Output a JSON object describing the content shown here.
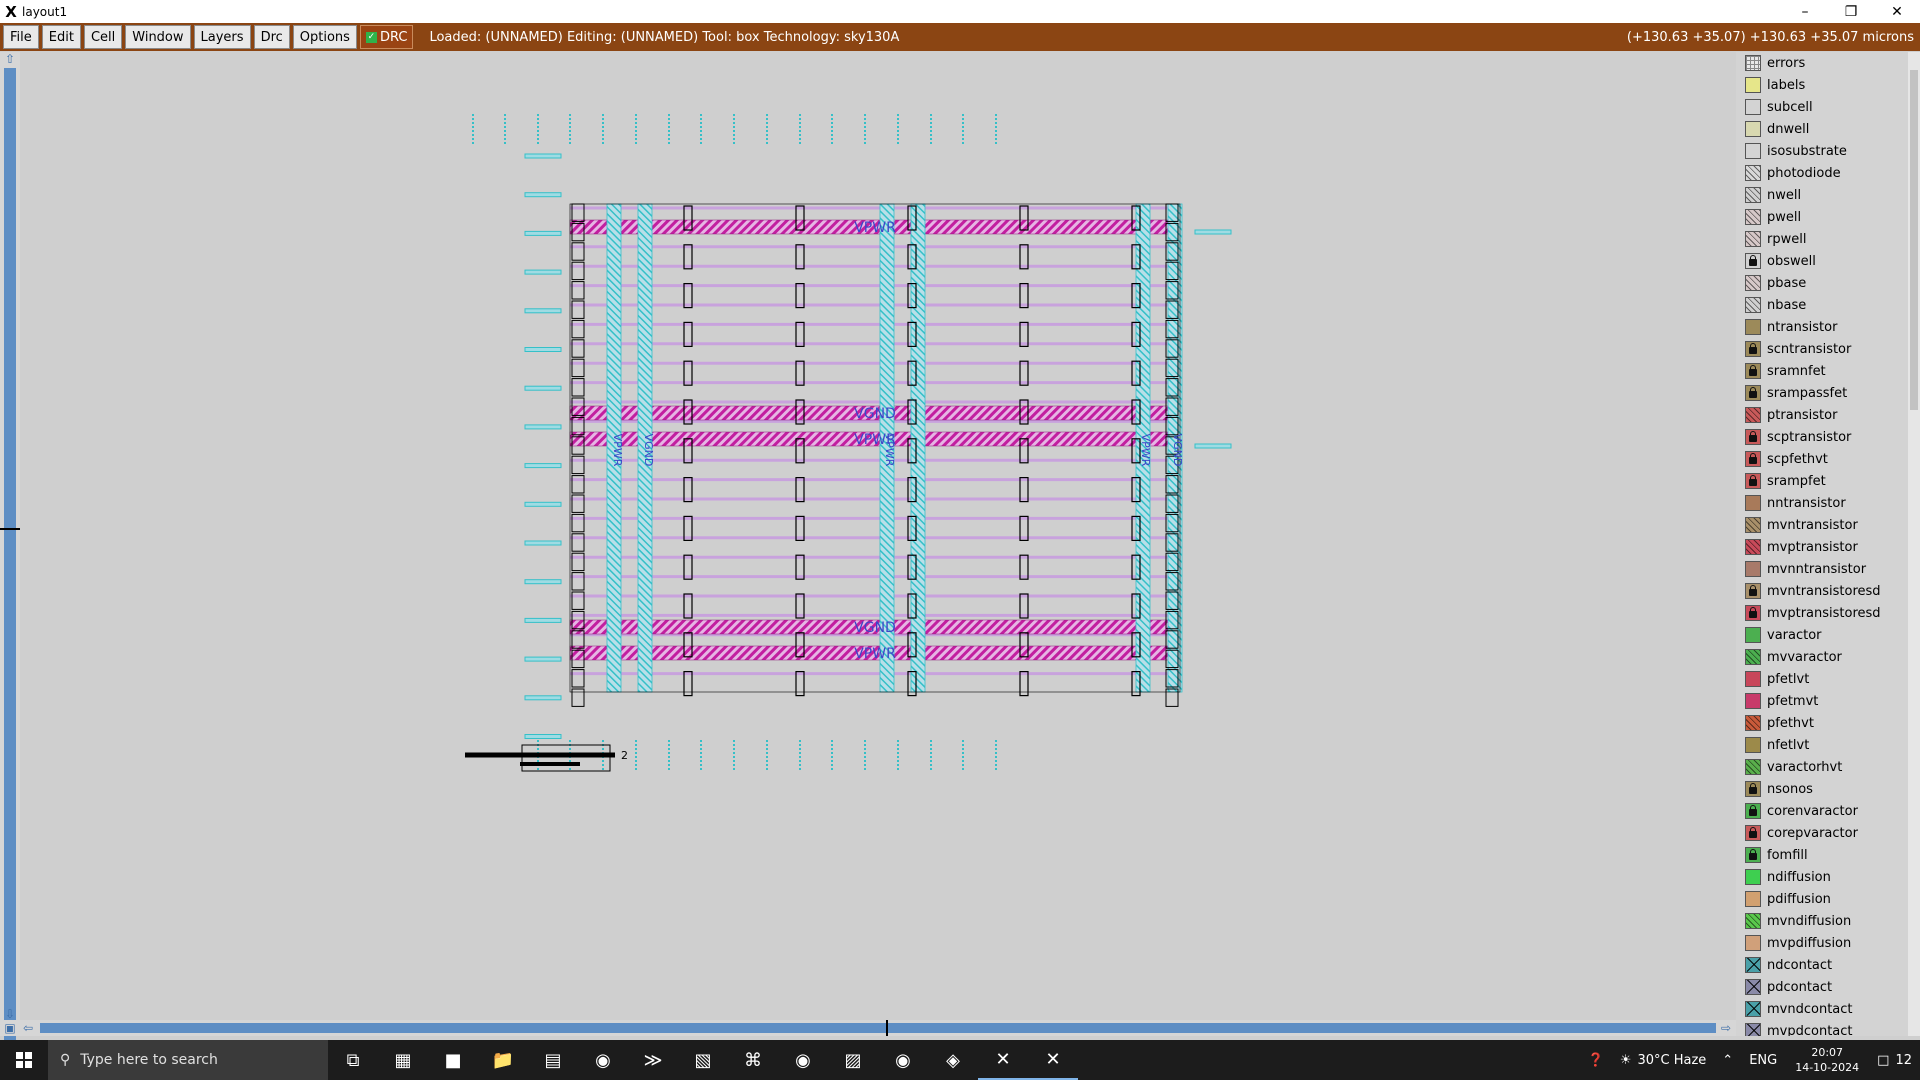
{
  "window": {
    "title": "layout1",
    "minimize_icon": "minimize-icon",
    "restore_icon": "restore-icon",
    "close_icon": "close-icon"
  },
  "menubar": {
    "menus": [
      "File",
      "Edit",
      "Cell",
      "Window",
      "Layers",
      "Drc",
      "Options"
    ],
    "drc_label": "DRC",
    "drc_checked": true,
    "status": "Loaded: (UNNAMED) Editing: (UNNAMED) Tool: box  Technology: sky130A",
    "coords": "(+130.63 +35.07) +130.63 +35.07 microns",
    "bg_color": "#8b4513"
  },
  "layout": {
    "horizontal_labels": [
      "VPWR",
      "VGND",
      "VPWR",
      "VGND",
      "VPWR"
    ],
    "vertical_labels": [
      "VPWR",
      "VGND",
      "VPWR",
      "VPWR",
      "VGND"
    ],
    "cell_label": "2",
    "colors": {
      "metal_hatch": "#c21fa0",
      "via_stripe": "#35c0c8",
      "wire": "#c79be0",
      "outline": "#000000",
      "label": "#3c46c8"
    }
  },
  "layers": [
    {
      "name": "errors",
      "color": "#e8e8e8",
      "pattern": "grid",
      "locked": false
    },
    {
      "name": "labels",
      "color": "#e6e68a",
      "pattern": "solid",
      "locked": false
    },
    {
      "name": "subcell",
      "color": "#dcdcdc",
      "pattern": "outline",
      "locked": false
    },
    {
      "name": "dnwell",
      "color": "#d8d8b0",
      "pattern": "solid",
      "locked": false
    },
    {
      "name": "isosubstrate",
      "color": "#d4d4d4",
      "pattern": "solid",
      "locked": false
    },
    {
      "name": "photodiode",
      "color": "#d8d8d8",
      "pattern": "hatch",
      "locked": false
    },
    {
      "name": "nwell",
      "color": "#d0d0d0",
      "pattern": "hatch",
      "locked": false
    },
    {
      "name": "pwell",
      "color": "#d6c8c8",
      "pattern": "hatch",
      "locked": false
    },
    {
      "name": "rpwell",
      "color": "#d6c8c8",
      "pattern": "hatch",
      "locked": false
    },
    {
      "name": "obswell",
      "color": "#d0d0d0",
      "pattern": "solid",
      "locked": true
    },
    {
      "name": "pbase",
      "color": "#d6c8c8",
      "pattern": "hatch",
      "locked": false
    },
    {
      "name": "nbase",
      "color": "#d0d0d0",
      "pattern": "hatch",
      "locked": false
    },
    {
      "name": "ntransistor",
      "color": "#9c8a5a",
      "pattern": "solid",
      "locked": false
    },
    {
      "name": "scntransistor",
      "color": "#9c8a5a",
      "pattern": "solid",
      "locked": true
    },
    {
      "name": "sramnfet",
      "color": "#9c8a5a",
      "pattern": "solid",
      "locked": true
    },
    {
      "name": "srampassfet",
      "color": "#9c8a5a",
      "pattern": "solid",
      "locked": true
    },
    {
      "name": "ptransistor",
      "color": "#c85a5a",
      "pattern": "hatch",
      "locked": false
    },
    {
      "name": "scptransistor",
      "color": "#c85a5a",
      "pattern": "solid",
      "locked": true
    },
    {
      "name": "scpfethvt",
      "color": "#c85a5a",
      "pattern": "solid",
      "locked": true
    },
    {
      "name": "srampfet",
      "color": "#c85a5a",
      "pattern": "solid",
      "locked": true
    },
    {
      "name": "nntransistor",
      "color": "#a87a5a",
      "pattern": "solid",
      "locked": false
    },
    {
      "name": "mvntransistor",
      "color": "#a8906a",
      "pattern": "hatch",
      "locked": false
    },
    {
      "name": "mvptransistor",
      "color": "#c84a5a",
      "pattern": "hatch",
      "locked": false
    },
    {
      "name": "mvnntransistor",
      "color": "#a87a6a",
      "pattern": "solid",
      "locked": false
    },
    {
      "name": "mvntransistoresd",
      "color": "#a8906a",
      "pattern": "solid",
      "locked": true
    },
    {
      "name": "mvptransistoresd",
      "color": "#c84a5a",
      "pattern": "solid",
      "locked": true
    },
    {
      "name": "varactor",
      "color": "#4caf50",
      "pattern": "solid",
      "locked": false
    },
    {
      "name": "mvvaractor",
      "color": "#4caf50",
      "pattern": "hatch",
      "locked": false
    },
    {
      "name": "pfetlvt",
      "color": "#c8465a",
      "pattern": "solid",
      "locked": false
    },
    {
      "name": "pfetmvt",
      "color": "#c83a6a",
      "pattern": "solid",
      "locked": false
    },
    {
      "name": "pfethvt",
      "color": "#c85a3a",
      "pattern": "hatch",
      "locked": false
    },
    {
      "name": "nfetlvt",
      "color": "#9c8a4a",
      "pattern": "solid",
      "locked": false
    },
    {
      "name": "varactorhvt",
      "color": "#5aaf4c",
      "pattern": "hatch",
      "locked": false
    },
    {
      "name": "nsonos",
      "color": "#9c8a5a",
      "pattern": "solid",
      "locked": true
    },
    {
      "name": "corenvaractor",
      "color": "#4caf50",
      "pattern": "solid",
      "locked": true
    },
    {
      "name": "corepvaractor",
      "color": "#c85a5a",
      "pattern": "solid",
      "locked": true
    },
    {
      "name": "fomfill",
      "color": "#4caf50",
      "pattern": "solid",
      "locked": true
    },
    {
      "name": "ndiffusion",
      "color": "#3ecf50",
      "pattern": "solid",
      "locked": false
    },
    {
      "name": "pdiffusion",
      "color": "#d1a070",
      "pattern": "solid",
      "locked": false
    },
    {
      "name": "mvndiffusion",
      "color": "#5ac84c",
      "pattern": "hatch",
      "locked": false
    },
    {
      "name": "mvpdiffusion",
      "color": "#d0a07a",
      "pattern": "solid",
      "locked": false
    },
    {
      "name": "ndcontact",
      "color": "#4aa0a8",
      "pattern": "xmark",
      "locked": false
    },
    {
      "name": "pdcontact",
      "color": "#8a8aa8",
      "pattern": "xmark",
      "locked": false
    },
    {
      "name": "mvndcontact",
      "color": "#4aa0a8",
      "pattern": "xmark",
      "locked": false
    },
    {
      "name": "mvpdcontact",
      "color": "#8a8aa8",
      "pattern": "xmark",
      "locked": false
    }
  ],
  "taskbar": {
    "search_placeholder": "Type here to search",
    "apps": [
      {
        "icon": "task-view-icon",
        "glyph": "⧉",
        "active": false
      },
      {
        "icon": "calculator-icon",
        "glyph": "▦",
        "active": false
      },
      {
        "icon": "app-icon",
        "glyph": "■",
        "active": false
      },
      {
        "icon": "file-explorer-icon",
        "glyph": "📁",
        "active": false
      },
      {
        "icon": "terminal-icon",
        "glyph": "▤",
        "active": false
      },
      {
        "icon": "chrome-icon",
        "glyph": "◉",
        "active": false
      },
      {
        "icon": "powershell-icon",
        "glyph": "≫",
        "active": false
      },
      {
        "icon": "notepad-icon",
        "glyph": "▧",
        "active": false
      },
      {
        "icon": "acrobat-icon",
        "glyph": "⌘",
        "active": false
      },
      {
        "icon": "chrome-icon",
        "glyph": "◉",
        "active": false
      },
      {
        "icon": "image-viewer-icon",
        "glyph": "▨",
        "active": false
      },
      {
        "icon": "chrome-icon",
        "glyph": "◉",
        "active": false
      },
      {
        "icon": "linux-icon",
        "glyph": "◈",
        "active": false
      },
      {
        "icon": "xserver-icon",
        "glyph": "✕",
        "active": true
      },
      {
        "icon": "xserver-icon",
        "glyph": "✕",
        "active": true
      }
    ],
    "weather": "30°C  Haze",
    "language": "ENG",
    "time": "20:07",
    "date": "14-10-2024",
    "notification_count": "12"
  }
}
